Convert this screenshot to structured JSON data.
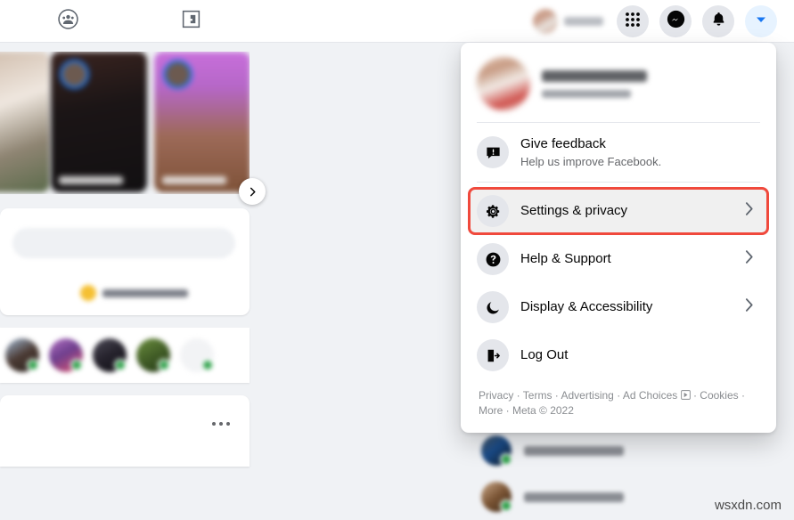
{
  "topnav": {
    "groups_icon": "groups-icon",
    "gaming_icon": "gaming-icon",
    "profile_name_hidden": "",
    "menu_icon": "grid-menu-icon",
    "messenger_icon": "messenger-icon",
    "notifications_icon": "bell-icon",
    "account_icon": "chevron-down-icon"
  },
  "feed": {
    "stories_next_label": "›",
    "post_more_label": "..."
  },
  "dropdown": {
    "profile": {
      "name": "",
      "subtitle": ""
    },
    "items": [
      {
        "id": "give-feedback",
        "label": "Give feedback",
        "sub": "Help us improve Facebook.",
        "icon": "feedback-icon",
        "chevron": false,
        "highlighted": false
      },
      {
        "id": "settings-privacy",
        "label": "Settings & privacy",
        "sub": "",
        "icon": "gear-icon",
        "chevron": true,
        "highlighted": true
      },
      {
        "id": "help-support",
        "label": "Help & Support",
        "sub": "",
        "icon": "question-mark-icon",
        "chevron": true,
        "highlighted": false
      },
      {
        "id": "display-accessibility",
        "label": "Display & Accessibility",
        "sub": "",
        "icon": "moon-icon",
        "chevron": true,
        "highlighted": false
      },
      {
        "id": "log-out",
        "label": "Log Out",
        "sub": "",
        "icon": "logout-icon",
        "chevron": false,
        "highlighted": false
      }
    ],
    "footer": {
      "privacy": "Privacy",
      "terms": "Terms",
      "advertising": "Advertising",
      "ad_choices": "Ad Choices",
      "cookies": "Cookies",
      "more": "More",
      "meta": "Meta © 2022",
      "separator": " · "
    }
  },
  "colors": {
    "highlight_red": "#f0493c",
    "facebook_blue": "#1877f2",
    "online_green": "#31a24c",
    "page_bg": "#f0f2f5"
  },
  "watermark": "wsxdn.com"
}
